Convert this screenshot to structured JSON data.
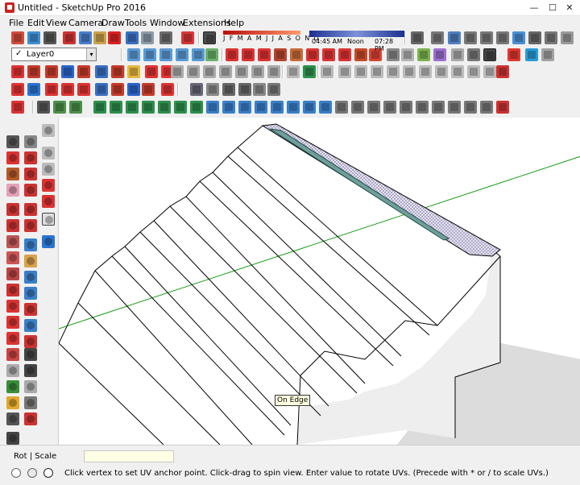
{
  "window": {
    "title": "Untitled - SketchUp Pro 2016",
    "minimize_label": "—",
    "maximize_label": "☐",
    "close_label": "✕"
  },
  "menu": [
    "File",
    "Edit",
    "View",
    "Camera",
    "Draw",
    "Tools",
    "Window",
    "Extensions",
    "Help"
  ],
  "layers": {
    "check": "✓",
    "current": "Layer0",
    "arrow": "▾"
  },
  "shadows": {
    "months": "J F M A M J J A S O N D",
    "time_start": "04:45 AM",
    "time_noon": "Noon",
    "time_end": "07:28 PM"
  },
  "viewport": {
    "tooltip": "On Edge"
  },
  "status": {
    "measurements_label": "Rot | Scale",
    "measurements_value": "",
    "message": "Click vertex to set UV anchor point. Click-drag to spin view.  Enter value to rotate UVs. (Precede with * or / to scale UVs.)"
  },
  "colors": {
    "accent_red": "#c8261f",
    "toolbar_bg": "#f0f0f0",
    "green_axis": "#1a9c1a",
    "selection_blue": "#3a63c8",
    "tooltip_bg": "#ffffe1",
    "vcb_bg": "#ffffe6"
  }
}
